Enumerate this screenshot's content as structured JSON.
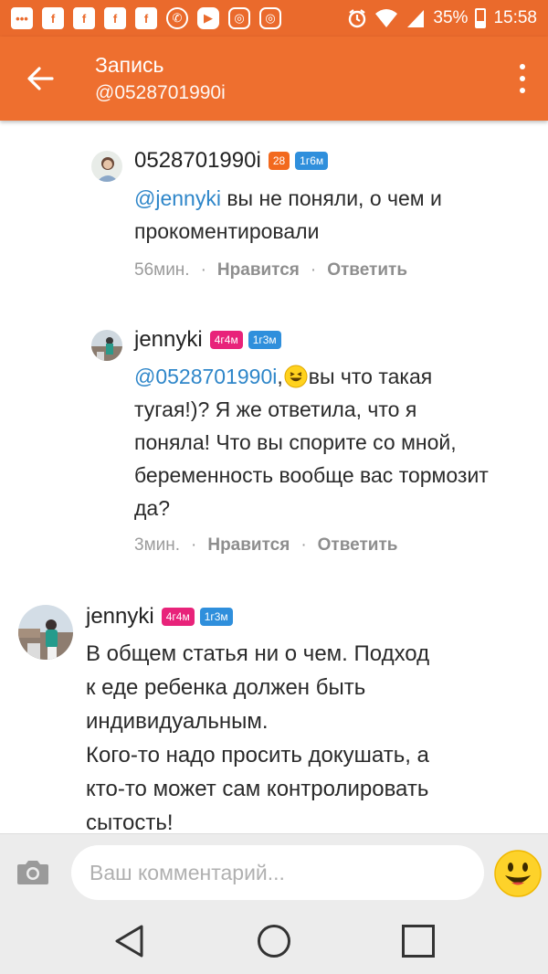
{
  "status_bar": {
    "battery": "35%",
    "time": "15:58",
    "notification_icons": [
      "messages-icon",
      "facebook-icon",
      "facebook-icon",
      "facebook-icon",
      "facebook-icon",
      "whatsapp-icon",
      "youtube-icon",
      "instagram-icon",
      "instagram-icon"
    ]
  },
  "toolbar": {
    "title": "Запись",
    "subtitle": "@0528701990i"
  },
  "comments": [
    {
      "username": "0528701990i",
      "badge1": "28",
      "badge1_color": "#f2691e",
      "badge2": "1г6м",
      "badge2_color": "#2f8fdc",
      "mention": "@jennyki",
      "text_line1": " вы не поняли, о чем и",
      "text_line2": "прокоментировали",
      "time": "56мин.",
      "like_label": "Нравится",
      "reply_label": "Ответить"
    },
    {
      "username": "jennyki",
      "badge1": "4г4м",
      "badge1_color": "#e8237a",
      "badge2": "1г3м",
      "badge2_color": "#2f8fdc",
      "mention": "@0528701990i",
      "text_after_mention": ", ",
      "text_line1_rest": "вы что такая",
      "text_line2": "тугая!)? Я же ответила, что я",
      "text_line3": "поняла! Что вы спорите со мной,",
      "text_line4": "беременность вообще вас тормозит",
      "text_line5": "да?",
      "time": "3мин.",
      "like_label": "Нравится",
      "reply_label": "Ответить"
    },
    {
      "username": "jennyki",
      "badge1": "4г4м",
      "badge1_color": "#e8237a",
      "badge2": "1г3м",
      "badge2_color": "#2f8fdc",
      "text_line1": "В общем статья ни о чем. Подход",
      "text_line2": "к еде ребенка должен быть",
      "text_line3": "индивидуальным.",
      "text_line4": "Кого-то надо просить докушать, а",
      "text_line5": "кто-то может сам контролировать",
      "text_line6": "сытость!"
    }
  ],
  "composer": {
    "placeholder": "Ваш комментарий..."
  },
  "colors": {
    "accent": "#ee6f2f",
    "mention": "#2e86c9"
  }
}
